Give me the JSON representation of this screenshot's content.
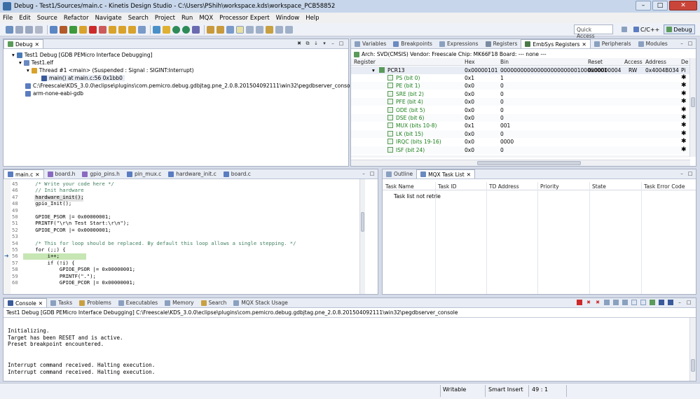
{
  "window": {
    "title": "Debug - Test1/Sources/main.c - Kinetis Design Studio - C:\\Users\\PShih\\workspace.kds\\workspace_PCB58852",
    "controls": [
      "–",
      "□",
      "✕"
    ]
  },
  "menu": [
    "File",
    "Edit",
    "Source",
    "Refactor",
    "Navigate",
    "Search",
    "Project",
    "Run",
    "MQX",
    "Processor Expert",
    "Window",
    "Help"
  ],
  "toolbar": {
    "quick_access": "Quick Access",
    "perspectives": [
      "C/C++",
      "Debug"
    ]
  },
  "debug_view": {
    "tab": "Debug",
    "tree": [
      "Test1 Debug [GDB PEMicro Interface Debugging]",
      "Test1.elf",
      "Thread #1 <main> (Suspended : Signal : SIGINT:Interrupt)",
      "main() at main.c:56 0x1bb0",
      "C:\\Freescale\\KDS_3.0.0\\eclipse\\plugins\\com.pemicro.debug.gdbjtag.pne_2.0.8.201504092111\\win32\\pegdbserver_console",
      "arm-none-eabi-gdb"
    ]
  },
  "registers_view": {
    "tabs": [
      "Variables",
      "Breakpoints",
      "Expressions",
      "Registers",
      "EmbSys Registers",
      "Peripherals",
      "Modules"
    ],
    "info": "Arch: SVD(CMSIS)  Vendor: Freescale  Chip: MK66F18  Board: --- none ---",
    "columns": [
      "Register",
      "Hex",
      "Bin",
      "Reset",
      "Access",
      "Address",
      "De"
    ],
    "pcr": {
      "name": "PCR13",
      "hex": "0x00000101",
      "bin": "00000000000000000000000100000001",
      "reset": "0x00000004",
      "access": "RW",
      "address": "0x4004B034",
      "de": "Pi"
    },
    "fields": [
      {
        "name": "PS (bit 0)",
        "hex": "0x1",
        "bin": "1"
      },
      {
        "name": "PE (bit 1)",
        "hex": "0x0",
        "bin": "0"
      },
      {
        "name": "SRE (bit 2)",
        "hex": "0x0",
        "bin": "0"
      },
      {
        "name": "PFE (bit 4)",
        "hex": "0x0",
        "bin": "0"
      },
      {
        "name": "ODE (bit 5)",
        "hex": "0x0",
        "bin": "0"
      },
      {
        "name": "DSE (bit 6)",
        "hex": "0x0",
        "bin": "0"
      },
      {
        "name": "MUX (bits 10-8)",
        "hex": "0x1",
        "bin": "001"
      },
      {
        "name": "LK (bit 15)",
        "hex": "0x0",
        "bin": "0"
      },
      {
        "name": "IRQC (bits 19-16)",
        "hex": "0x0",
        "bin": "0000"
      },
      {
        "name": "ISF (bit 24)",
        "hex": "0x0",
        "bin": "0"
      }
    ]
  },
  "editor": {
    "tabs": [
      "main.c",
      "board.h",
      "gpio_pins.h",
      "pin_mux.c",
      "hardware_init.c",
      "board.c"
    ],
    "lines": [
      {
        "n": "45",
        "t": "    /* Write your code here */"
      },
      {
        "n": "46",
        "t": "    // Init hardware"
      },
      {
        "n": "47",
        "t": "    hardware_init();"
      },
      {
        "n": "48",
        "t": "    gpio_Init();"
      },
      {
        "n": "49",
        "t": ""
      },
      {
        "n": "50",
        "t": "    GPIOE_PSOR |= 0x00000001;"
      },
      {
        "n": "51",
        "t": "    PRINTF(\"\\r\\n Test Start:\\r\\n\");"
      },
      {
        "n": "52",
        "t": "    GPIOE_PCOR |= 0x00000001;"
      },
      {
        "n": "53",
        "t": ""
      },
      {
        "n": "54",
        "t": "    /* This for loop should be replaced. By default this loop allows a single stepping. */"
      },
      {
        "n": "55",
        "t": "    for (;;) {"
      },
      {
        "n": "56",
        "t": "        i++;"
      },
      {
        "n": "57",
        "t": "        if (!i) {"
      },
      {
        "n": "58",
        "t": "            GPIOE_PSOR |= 0x00000001;"
      },
      {
        "n": "59",
        "t": "            PRINTF(\".\");"
      },
      {
        "n": "60",
        "t": "            GPIOE_PCOR |= 0x00000001;"
      }
    ]
  },
  "mqx_view": {
    "tabs": [
      "Outline",
      "MQX Task List"
    ],
    "columns": [
      "Task Name",
      "Task ID",
      "TD Address",
      "Priority",
      "State",
      "Task Error Code"
    ],
    "message": "Task list not retrie"
  },
  "console": {
    "tabs": [
      "Console",
      "Tasks",
      "Problems",
      "Executables",
      "Memory",
      "Search",
      "MQX Stack Usage"
    ],
    "header": "Test1 Debug [GDB PEMicro Interface Debugging] C:\\Freescale\\KDS_3.0.0\\eclipse\\plugins\\com.pemicro.debug.gdbjtag.pne_2.0.8.201504092111\\win32\\pegdbserver_console",
    "lines": [
      "",
      "Initializing.",
      "Target has been RESET and is active.",
      "Preset breakpoint encountered.",
      "",
      "",
      "Interrupt command received. Halting execution.",
      "Interrupt command received. Halting execution."
    ]
  },
  "status": {
    "mode": "Writable",
    "insert": "Smart Insert",
    "position": "49 : 1"
  }
}
